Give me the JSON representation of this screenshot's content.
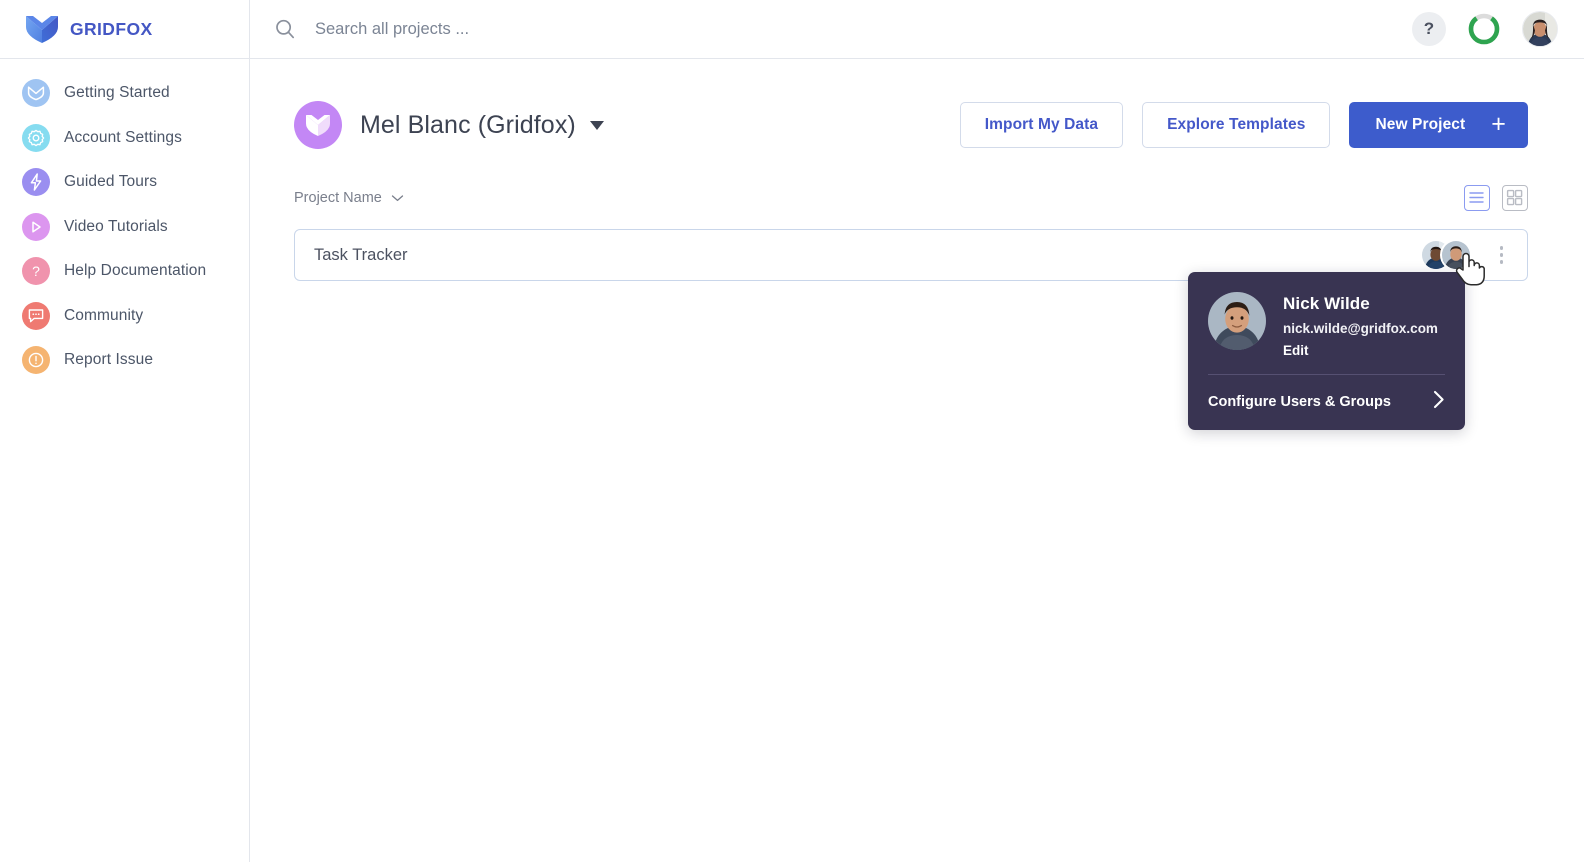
{
  "brand": {
    "name": "GRIDFOX",
    "logo_icon": "fox-logo-icon",
    "color": "#4457c4"
  },
  "sidebar": {
    "items": [
      {
        "label": "Getting Started",
        "icon": "fox-icon",
        "bg": "#9fc4f2",
        "fg": "#ffffff"
      },
      {
        "label": "Account Settings",
        "icon": "gear-icon",
        "bg": "#86dcf0",
        "fg": "#ffffff"
      },
      {
        "label": "Guided Tours",
        "icon": "lightning-icon",
        "bg": "#9a8ef0",
        "fg": "#ffffff"
      },
      {
        "label": "Video Tutorials",
        "icon": "play-icon",
        "bg": "#dc96ef",
        "fg": "#ffffff"
      },
      {
        "label": "Help Documentation",
        "icon": "question-icon",
        "bg": "#f093ad",
        "fg": "#ffffff"
      },
      {
        "label": "Community",
        "icon": "chat-icon",
        "bg": "#ef7a72",
        "fg": "#ffffff"
      },
      {
        "label": "Report Issue",
        "icon": "warning-icon",
        "bg": "#f5b471",
        "fg": "#ffffff"
      }
    ]
  },
  "topbar": {
    "search": {
      "placeholder": "Search all projects ...",
      "value": "",
      "icon": "search-icon"
    },
    "help_label": "?",
    "progress_ring": {
      "percent": 80,
      "color": "#2ea44f",
      "track": "#dcdcdc"
    },
    "avatar_alt": "user-avatar"
  },
  "project_header": {
    "avatar_icon": "fox-avatar-icon",
    "avatar_bg": "#c387f5",
    "title": "Mel Blanc (Gridfox)",
    "caret_icon": "caret-down-icon"
  },
  "actions": {
    "import_label": "Import My Data",
    "templates_label": "Explore Templates",
    "new_project_label": "New Project",
    "new_project_icon": "plus-icon",
    "primary_color": "#3d5ccc"
  },
  "sort": {
    "label": "Project Name",
    "icon": "chevron-down-icon"
  },
  "views": {
    "list_icon": "list-view-icon",
    "grid_icon": "grid-view-icon",
    "active": "list"
  },
  "projects": [
    {
      "name": "Task Tracker",
      "members": [
        "member-avatar-1",
        "member-avatar-2"
      ],
      "menu_icon": "kebab-menu-icon"
    }
  ],
  "popover": {
    "avatar_alt": "nick-wilde-avatar",
    "name": "Nick Wilde",
    "email": "nick.wilde@gridfox.com",
    "edit_label": "Edit",
    "configure_label": "Configure Users & Groups",
    "configure_icon": "chevron-right-icon",
    "bg": "#393452"
  },
  "chat_fab": {
    "icon": "chat-bubble-icon",
    "color": "#3b82f6"
  }
}
